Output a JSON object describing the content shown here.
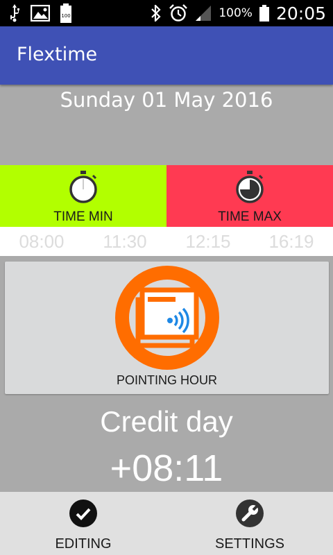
{
  "status_bar": {
    "battery_percent": "100%",
    "time": "20:05",
    "battery_icon_level": "100"
  },
  "app_bar": {
    "title": "Flextime"
  },
  "date": {
    "text": "Sunday 01 May 2016"
  },
  "panels": {
    "time_min": {
      "label": "TIME MIN",
      "color": "#b2ff00"
    },
    "time_max": {
      "label": "TIME MAX",
      "color": "#ff3a52"
    }
  },
  "times": [
    "08:00",
    "11:30",
    "12:15",
    "16:19"
  ],
  "pointing": {
    "label": "POINTING HOUR",
    "icon_color": "#ff6d00"
  },
  "credit": {
    "label": "Credit day",
    "value": "+08:11"
  },
  "bottom_nav": {
    "editing_label": "EDITING",
    "settings_label": "SETTINGS"
  },
  "colors": {
    "app_bar": "#3f51b5",
    "background": "#aaaaaa"
  }
}
